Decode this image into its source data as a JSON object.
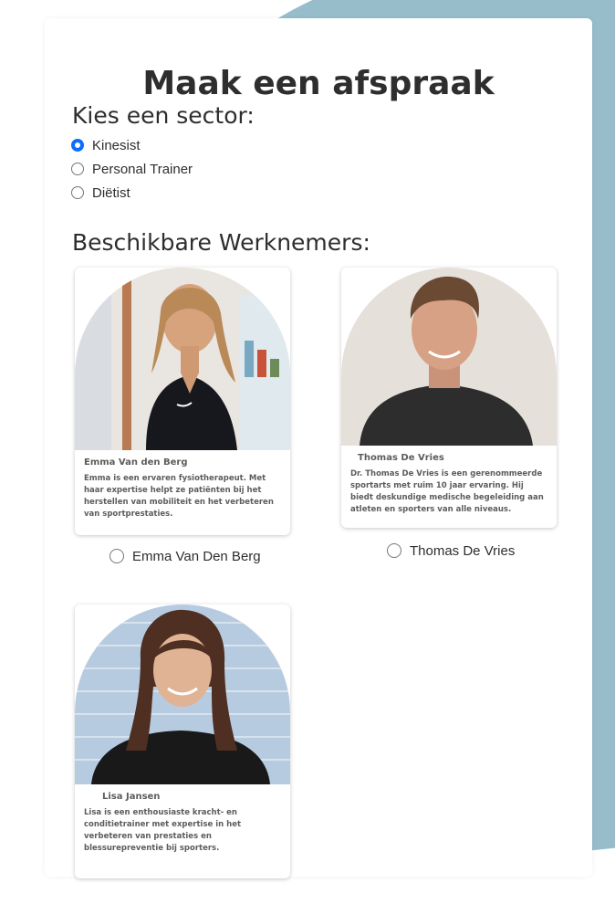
{
  "page": {
    "title": "Maak een afspraak",
    "sector_heading": "Kies een sector:",
    "employees_heading": "Beschikbare Werknemers:"
  },
  "sectors": [
    {
      "label": "Kinesist",
      "selected": true
    },
    {
      "label": "Personal Trainer",
      "selected": false
    },
    {
      "label": "Diëtist",
      "selected": false
    }
  ],
  "employees": [
    {
      "card_name": "Emma Van den Berg",
      "description": "Emma is een ervaren fysiotherapeut. Met haar expertise helpt ze patiënten bij het herstellen van mobiliteit en het verbeteren van sportprestaties.",
      "radio_label": "Emma Van Den Berg",
      "selected": false
    },
    {
      "card_name": "Thomas De Vries",
      "description": "Dr. Thomas De Vries is een gerenommeerde sportarts met ruim 10 jaar ervaring. Hij biedt deskundige medische begeleiding aan atleten en sporters van alle niveaus.",
      "radio_label": "Thomas De Vries",
      "selected": false
    },
    {
      "card_name": "Lisa Jansen",
      "description": "Lisa is een enthousiaste kracht- en conditietrainer met expertise in het verbeteren van prestaties en blessurepreventie bij sporters.",
      "selected": false
    }
  ],
  "colors": {
    "background_shape": "#97bdcb",
    "accent": "#0b6efd",
    "text": "#2e2e2e"
  }
}
